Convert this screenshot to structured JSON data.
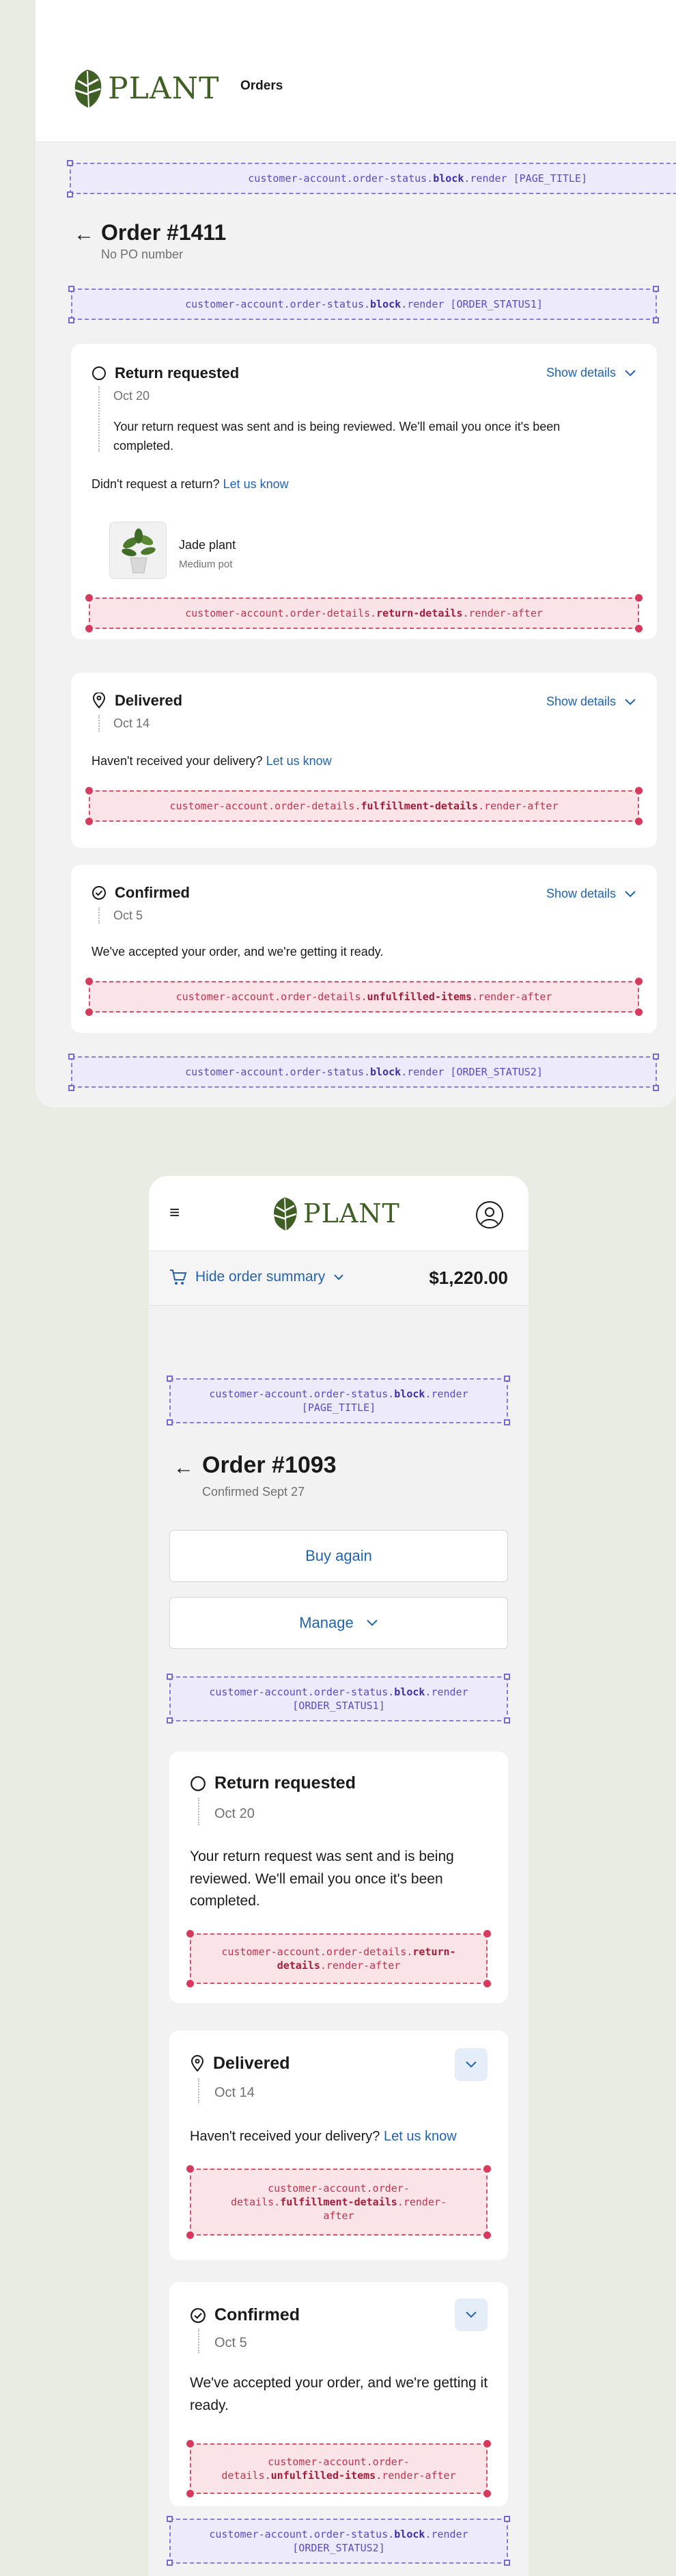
{
  "brand": {
    "name": "PLANT"
  },
  "colors": {
    "brand_green": "#3f5f24",
    "link_blue": "#2263b0",
    "ext_purple": "#5b4bc4",
    "ext_red": "#c2334f"
  },
  "desktop": {
    "nav_orders": "Orders",
    "page_title_target": {
      "prefix": "customer-account.order-status.",
      "bold": "block",
      "suffix": ".render [PAGE_TITLE]"
    },
    "order_title": "Order #1411",
    "order_subtitle": "No PO number",
    "order_status1_target": {
      "prefix": "customer-account.order-status.",
      "bold": "block",
      "suffix": ".render [ORDER_STATUS1]"
    },
    "return_card": {
      "status": "Return requested",
      "show_details": "Show details",
      "date": "Oct 20",
      "message": "Your return request was sent and is being reviewed. We'll email you once it's been completed.",
      "question": "Didn't request a return?",
      "question_link": "Let us know",
      "product_name": "Jade plant",
      "product_variant": "Medium pot",
      "target": {
        "prefix": "customer-account.order-details.",
        "bold": "return-details",
        "suffix": ".render-after"
      }
    },
    "delivered_card": {
      "status": "Delivered",
      "show_details": "Show details",
      "date": "Oct 14",
      "question": "Haven't received your delivery?",
      "question_link": "Let us know",
      "target": {
        "prefix": "customer-account.order-details.",
        "bold": "fulfillment-details",
        "suffix": ".render-after"
      }
    },
    "confirmed_card": {
      "status": "Confirmed",
      "show_details": "Show details",
      "date": "Oct 5",
      "message": "We've accepted your order, and we're getting it ready.",
      "target": {
        "prefix": "customer-account.order-details.",
        "bold": "unfulfilled-items",
        "suffix": ".render-after"
      }
    },
    "order_status2_target": {
      "prefix": "customer-account.order-status.",
      "bold": "block",
      "suffix": ".render [ORDER_STATUS2]"
    }
  },
  "mobile": {
    "summary_toggle": "Hide order summary",
    "summary_total": "$1,220.00",
    "page_title_target": {
      "line1_prefix": "customer-account.order-status.",
      "line1_bold": "block",
      "line1_suffix": ".render",
      "line2": "[PAGE_TITLE]"
    },
    "order_title": "Order #1093",
    "order_subtitle": "Confirmed Sept 27",
    "buy_again": "Buy again",
    "manage": "Manage",
    "order_status1_target": {
      "line1_prefix": "customer-account.order-status.",
      "line1_bold": "block",
      "line1_suffix": ".render",
      "line2": "[ORDER_STATUS1]"
    },
    "return_card": {
      "status": "Return requested",
      "date": "Oct 20",
      "message": "Your return request was sent and is being reviewed. We'll email you once it's been completed.",
      "target": {
        "line1_prefix": "customer-account.order-details.",
        "line1_bold": "return-",
        "line2_bold": "details",
        "line2_suffix": ".render-after"
      }
    },
    "delivered_card": {
      "status": "Delivered",
      "date": "Oct 14",
      "question": "Haven't received your delivery?",
      "question_link": "Let us know",
      "target": {
        "line1": "customer-account.order-",
        "line2_prefix": "details.",
        "line2_bold": "fulfillment-details",
        "line2_suffix": ".render-",
        "line3": "after"
      }
    },
    "confirmed_card": {
      "status": "Confirmed",
      "date": "Oct 5",
      "message": "We've accepted your order, and we're getting it ready.",
      "target": {
        "line1": "customer-account.order-",
        "line2_prefix": "details.",
        "line2_bold": "unfulfilled-items",
        "line2_suffix": ".render-after"
      }
    },
    "order_status2_target": {
      "line1_prefix": "customer-account.order-status.",
      "line1_bold": "block",
      "line1_suffix": ".render",
      "line2": "[ORDER_STATUS2]"
    }
  }
}
